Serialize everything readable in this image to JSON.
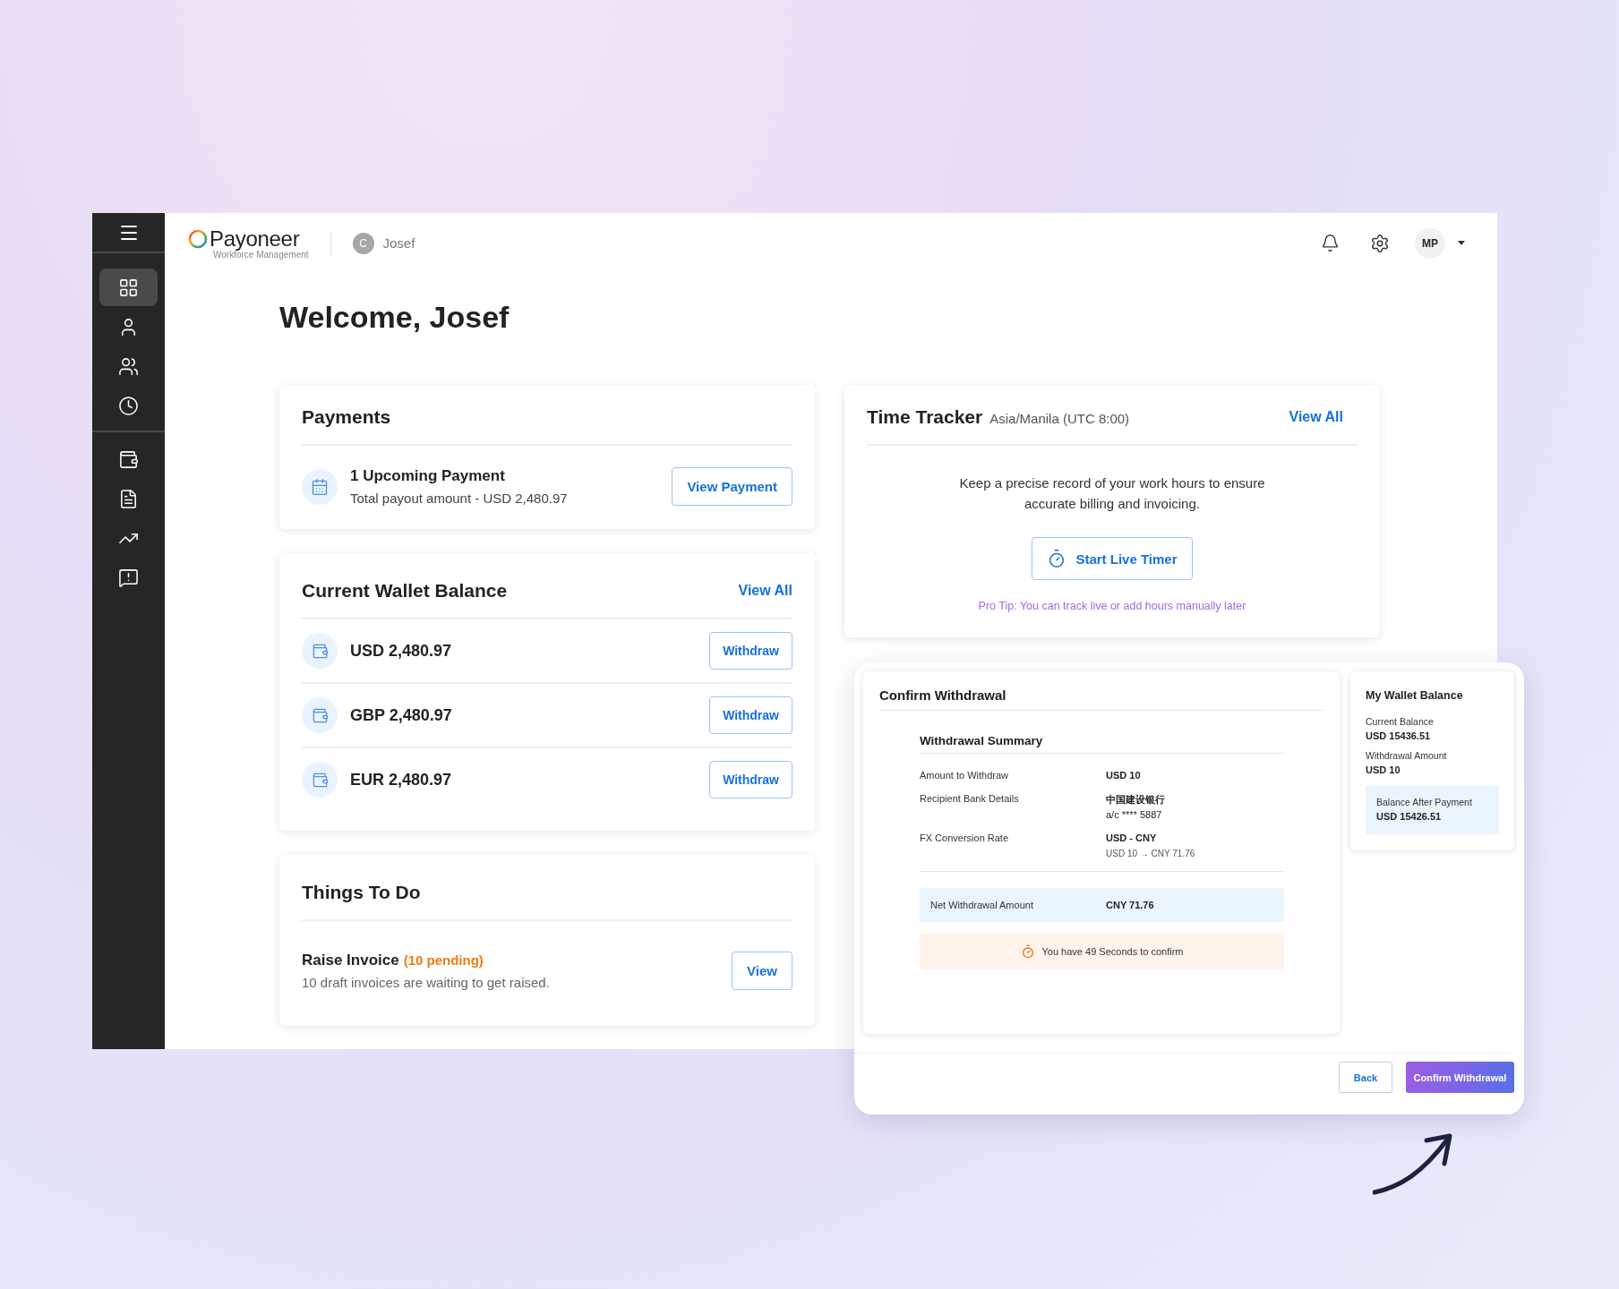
{
  "sidebar": {
    "items": [
      {
        "kind": "grid",
        "selected": true
      },
      {
        "kind": "person",
        "selected": false
      },
      {
        "kind": "people",
        "selected": false
      },
      {
        "kind": "clock",
        "selected": false
      },
      {
        "kind": "wallet",
        "selected": false
      },
      {
        "kind": "document",
        "selected": false
      },
      {
        "kind": "chart",
        "selected": false
      },
      {
        "kind": "feedback",
        "selected": false
      }
    ]
  },
  "header": {
    "brand": "Payoneer",
    "brand_subtitle": "Workforce Management",
    "account_initial": "C",
    "account_name": "Josef",
    "user_initials": "MP"
  },
  "welcome": "Welcome, Josef",
  "payments": {
    "title": "Payments",
    "headline": "1 Upcoming Payment",
    "detail": "Total payout amount - USD 2,480.97",
    "button": "View Payment"
  },
  "wallet": {
    "title": "Current Wallet Balance",
    "link": "View All",
    "balances": [
      {
        "amount": "USD 2,480.97",
        "button": "Withdraw"
      },
      {
        "amount": "GBP 2,480.97",
        "button": "Withdraw"
      },
      {
        "amount": "EUR 2,480.97",
        "button": "Withdraw"
      }
    ]
  },
  "todo": {
    "title": "Things To Do",
    "items": [
      {
        "title": "Raise Invoice",
        "badge": "(10 pending)",
        "detail": "10 draft invoices are waiting to get raised.",
        "button": "View"
      }
    ]
  },
  "time_tracker": {
    "title": "Time Tracker",
    "timezone": "Asia/Manila (UTC 8:00)",
    "link": "View All",
    "description": "Keep a precise record of your work hours to ensure accurate billing and invoicing.",
    "button": "Start Live Timer",
    "tip": "Pro Tip: You can track live or add hours manually later"
  },
  "confirm_dialog": {
    "title": "Confirm Withdrawal",
    "summary_title": "Withdrawal Summary",
    "rows": [
      {
        "label": "Amount to Withdraw",
        "values": [
          {
            "text": "USD 10",
            "kind": "strong"
          }
        ]
      },
      {
        "label": "Recipient Bank Details",
        "values": [
          {
            "text": "中国建设银行",
            "kind": "strong"
          },
          {
            "text": "a/c **** 5887",
            "kind": "plain"
          }
        ]
      },
      {
        "label": "FX Conversion Rate",
        "values": [
          {
            "text": "USD - CNY",
            "kind": "strong"
          },
          {
            "text": "USD 10 → CNY 71.76",
            "kind": "small"
          }
        ]
      }
    ],
    "net": {
      "label": "Net Withdrawal Amount",
      "value": "CNY 71.76"
    },
    "countdown": "You have 49 Seconds to confirm",
    "wallet": {
      "title": "My Wallet Balance",
      "items": [
        {
          "label": "Current Balance",
          "value": "USD 15436.51"
        },
        {
          "label": "Withdrawal Amount",
          "value": "USD 10"
        }
      ],
      "after": {
        "label": "Balance After Payment",
        "value": "USD 15426.51"
      }
    },
    "buttons": [
      {
        "label": "Back",
        "kind": "secondary"
      },
      {
        "label": "Confirm Withdrawal",
        "kind": "primary"
      }
    ]
  }
}
